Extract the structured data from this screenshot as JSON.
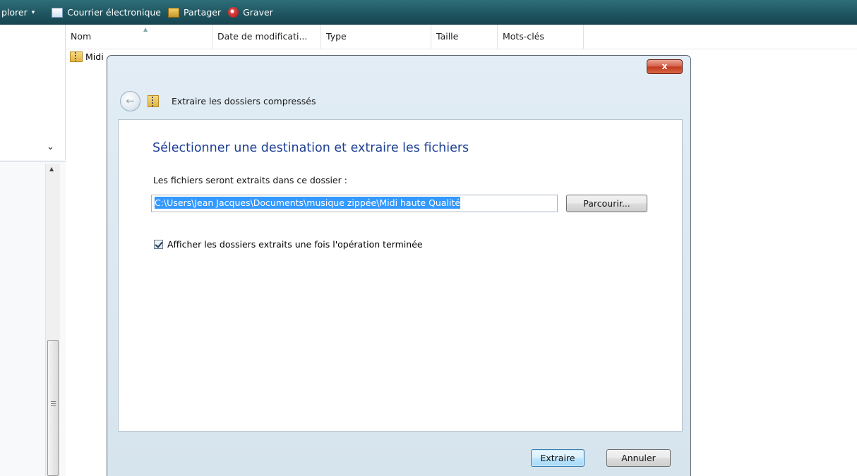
{
  "toolbar": {
    "explorer_label": "plorer",
    "explorer_arrow": "▾",
    "email": "Courrier électronique",
    "share": "Partager",
    "burn": "Graver"
  },
  "columns": {
    "name": "Nom",
    "modified": "Date de modificati...",
    "type": "Type",
    "size": "Taille",
    "keywords": "Mots-clés"
  },
  "file_row": {
    "name_visible": "Midi"
  },
  "left_pane": {
    "chevron": "⌄"
  },
  "dialog": {
    "close_label": "x",
    "header_title": "Extraire les dossiers compressés",
    "instruction": "Sélectionner une destination et extraire les fichiers",
    "path_label": "Les fichiers seront extraits dans ce dossier :",
    "path_value": "C:\\Users\\Jean Jacques\\Documents\\musique zippée\\Midi haute Qualité",
    "browse_label": "Parcourir...",
    "checkbox_label": "Afficher les dossiers extraits une fois l'opération terminée",
    "checkbox_checked": true,
    "extract_label": "Extraire",
    "cancel_label": "Annuler"
  },
  "colors": {
    "toolbar_bg": "#1f5560",
    "instruction_text": "#1c3f94",
    "selection": "#3399ff",
    "close_button": "#c2391e"
  }
}
